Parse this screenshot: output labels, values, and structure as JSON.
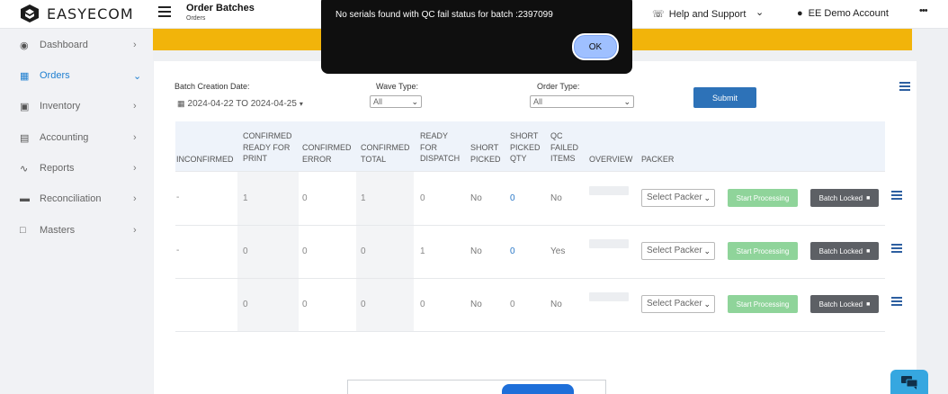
{
  "header": {
    "logo_text": "EASYECOM",
    "page_title": "Order Batches",
    "page_subtitle": "Orders",
    "help_label": "Help and Support",
    "account_label": "EE Demo Account",
    "more": "•••"
  },
  "sidebar": {
    "items": [
      {
        "label": "Dashboard",
        "icon": "dashboard-icon"
      },
      {
        "label": "Orders",
        "icon": "orders-grid-icon",
        "active": true
      },
      {
        "label": "Inventory",
        "icon": "inventory-bag-icon"
      },
      {
        "label": "Accounting",
        "icon": "accounting-book-icon"
      },
      {
        "label": "Reports",
        "icon": "reports-chart-icon"
      },
      {
        "label": "Reconciliation",
        "icon": "reconciliation-icon"
      },
      {
        "label": "Masters",
        "icon": "masters-note-icon"
      }
    ]
  },
  "filters": {
    "batch_date_label": "Batch Creation Date:",
    "batch_date_value": "2024-04-22 TO 2024-04-25",
    "wave_type_label": "Wave Type:",
    "wave_type_value": "All",
    "order_type_label": "Order Type:",
    "order_type_value": "All",
    "submit_label": "Submit"
  },
  "table": {
    "headers": {
      "inconfirmed": "INCONFIRMED",
      "confirmed_ready_for_print": "CONFIRMED READY FOR PRINT",
      "confirmed_error": "CONFIRMED ERROR",
      "confirmed_total": "CONFIRMED TOTAL",
      "ready_for_dispatch": "READY FOR DISPATCH",
      "short_picked": "SHORT PICKED",
      "short_picked_qty": "SHORT PICKED QTY",
      "qc_failed_items": "QC FAILED ITEMS",
      "overview": "OVERVIEW",
      "packer": "PACKER"
    },
    "rows": [
      {
        "inconfirmed": "-",
        "ready_for_print": "1",
        "error": "0",
        "total": "1",
        "dispatch": "0",
        "short_picked": "No",
        "short_qty": "0",
        "qc_failed": "No",
        "packer": "Select Packer",
        "start": "Start Processing",
        "locked": "Batch Locked"
      },
      {
        "inconfirmed": "-",
        "ready_for_print": "0",
        "error": "0",
        "total": "0",
        "dispatch": "1",
        "short_picked": "No",
        "short_qty": "0",
        "qc_failed": "Yes",
        "packer": "Select Packer",
        "start": "Start Processing",
        "locked": "Batch Locked"
      },
      {
        "inconfirmed": "",
        "ready_for_print": "0",
        "error": "0",
        "total": "0",
        "dispatch": "0",
        "short_picked": "No",
        "short_qty": "0",
        "qc_failed": "No",
        "packer": "Select Packer",
        "start": "Start Processing",
        "locked": "Batch Locked"
      }
    ]
  },
  "toast": {
    "message": "No serials found with QC fail status for batch :2397099",
    "ok_label": "OK"
  },
  "colors": {
    "brand_blue": "#2d72b8",
    "banner_yellow": "#f2b40a",
    "start_green": "#8fd49a",
    "locked_gray": "#5d6065",
    "toast_bg": "#0f0f0f"
  }
}
